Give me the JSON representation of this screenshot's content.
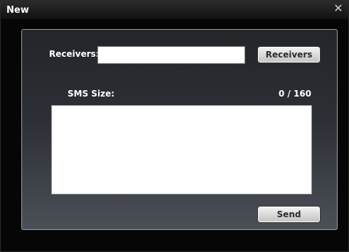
{
  "window": {
    "title": "New",
    "close_glyph": "✕",
    "close_icon": "close-icon"
  },
  "form": {
    "receivers_label": "Receivers:",
    "receivers_value": "",
    "receivers_button": "Receivers",
    "sms_size_label": "SMS Size:",
    "counter": "0 / 160",
    "message_value": "",
    "send_button": "Send"
  },
  "colors": {
    "window_bg": "#060606",
    "panel_top": "#232529",
    "panel_bottom": "#4b4f57",
    "text": "#ffffff"
  }
}
